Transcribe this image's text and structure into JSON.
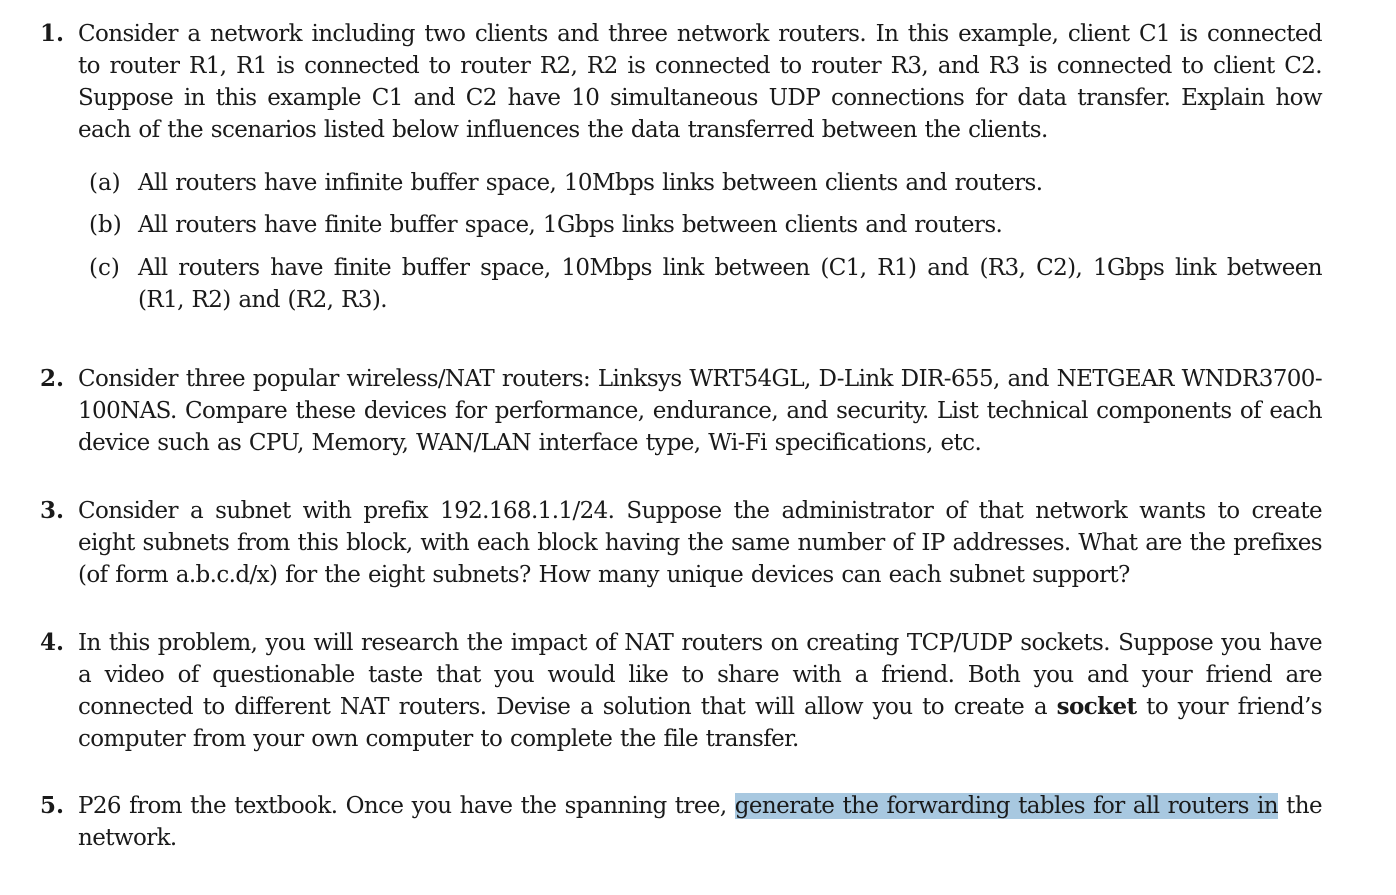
{
  "problems": [
    {
      "number": "1.",
      "text": "Consider a network including two clients and three network routers. In this example, client C1 is connected to router R1, R1 is connected to router R2, R2 is connected to router R3, and R3 is connected to client C2. Suppose in this example C1 and C2 have 10 simultaneous UDP connections for data transfer. Explain how each of the scenarios listed below influences the data transferred between the clients.",
      "parts": [
        {
          "label": "(a)",
          "text": "All routers have infinite buffer space, 10Mbps links between clients and routers."
        },
        {
          "label": "(b)",
          "text": "All routers have finite buffer space, 1Gbps links between clients and routers."
        },
        {
          "label": "(c)",
          "text": "All routers have finite buffer space, 10Mbps link between (C1, R1) and (R3, C2), 1Gbps link between (R1, R2) and (R2, R3)."
        }
      ]
    },
    {
      "number": "2.",
      "text": "Consider three popular wireless/NAT routers: Linksys WRT54GL, D-Link DIR-655, and NETGEAR WNDR3700-100NAS. Compare these devices for performance, endurance, and security. List technical components of each device such as CPU, Memory, WAN/LAN interface type, Wi-Fi specifications, etc."
    },
    {
      "number": "3.",
      "text": "Consider a subnet with prefix 192.168.1.1/24. Suppose the administrator of that network wants to create eight subnets from this block, with each block having the same number of IP addresses. What are the prefixes (of form a.b.c.d/x) for the eight subnets? How many unique devices can each subnet support?"
    },
    {
      "number": "4.",
      "text_before": "In this problem, you will research the impact of NAT routers on creating TCP/UDP sockets. Suppose you have a video of questionable taste that you would like to share with a friend. Both you and your friend are connected to different NAT routers. Devise a solution that will allow you to create a ",
      "bold": "socket",
      "text_after": " to your friend’s computer from your own computer to complete the file transfer."
    },
    {
      "number": "5.",
      "text_before": "P26 from the textbook. Once you have the spanning tree, ",
      "highlighted": "generate the forwarding tables for all routers in",
      "text_after": " the network."
    }
  ],
  "colors": {
    "text": "#1a1a1a",
    "highlight": "#a8c8e0",
    "background": "#ffffff"
  }
}
